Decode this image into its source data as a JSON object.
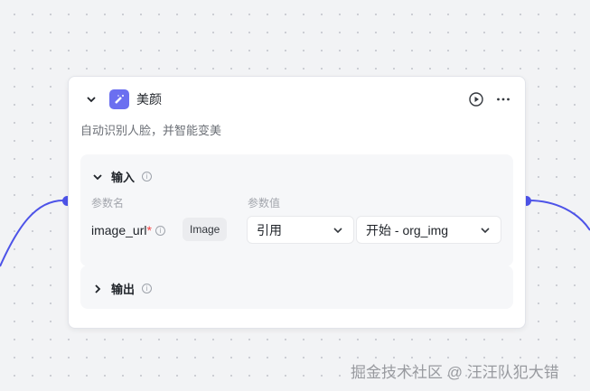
{
  "node": {
    "title": "美颜",
    "description": "自动识别人脸，并智能变美",
    "accent": "#4d53e8"
  },
  "input_section": {
    "title": "输入",
    "col_name": "参数名",
    "col_value": "参数值",
    "param": {
      "name": "image_url",
      "required_mark": "*",
      "type": "Image",
      "ref_mode": "引用",
      "ref_value": "开始 - org_img"
    }
  },
  "output_section": {
    "title": "输出"
  },
  "info_glyph": "i",
  "watermark": "掘金技术社区 @ 汪汪队犯大错"
}
